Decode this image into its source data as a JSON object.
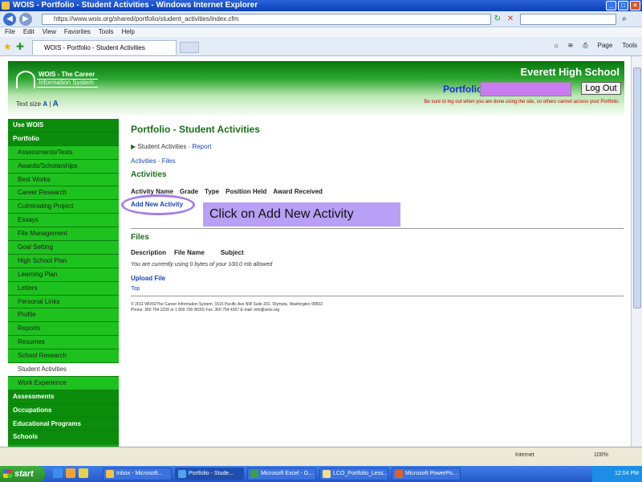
{
  "browser": {
    "title": "WOIS - Portfolio - Student Activities - Windows Internet Explorer",
    "url": "https://www.wois.org/shared/portfolio/student_activities/index.cfm",
    "search_placeholder": "",
    "menu": [
      "File",
      "Edit",
      "View",
      "Favorites",
      "Tools",
      "Help"
    ],
    "tab_label": "WOIS - Portfolio - Student Activities",
    "commands": [
      "Page",
      "Tools"
    ]
  },
  "header": {
    "logo_name": "WOIS - The Career",
    "logo_sub": "Information System",
    "text_size_label": "Text size",
    "text_size_small": "A",
    "text_size_large": "A",
    "school": "Everett High School",
    "portfolio_label": "Portfolio:",
    "logout": "Log Out",
    "warning": "Be sure to log out when you are done using the site, so others cannot access your Portfolio."
  },
  "sidebar": {
    "items": [
      {
        "label": "Use WOIS",
        "kind": "section"
      },
      {
        "label": "Portfolio",
        "kind": "section"
      },
      {
        "label": "Assessments/Tests",
        "kind": "sub"
      },
      {
        "label": "Awards/Scholarships",
        "kind": "sub"
      },
      {
        "label": "Best Works",
        "kind": "sub"
      },
      {
        "label": "Career Research",
        "kind": "sub"
      },
      {
        "label": "Culminating Project",
        "kind": "sub"
      },
      {
        "label": "Essays",
        "kind": "sub"
      },
      {
        "label": "File Management",
        "kind": "sub"
      },
      {
        "label": "Goal Setting",
        "kind": "sub"
      },
      {
        "label": "High School Plan",
        "kind": "sub"
      },
      {
        "label": "Learning Plan",
        "kind": "sub"
      },
      {
        "label": "Letters",
        "kind": "sub"
      },
      {
        "label": "Personal Links",
        "kind": "sub"
      },
      {
        "label": "Profile",
        "kind": "sub"
      },
      {
        "label": "Reports",
        "kind": "sub"
      },
      {
        "label": "Resumes",
        "kind": "sub"
      },
      {
        "label": "School Research",
        "kind": "sub"
      },
      {
        "label": "Student Activities",
        "kind": "sub"
      },
      {
        "label": "Work Experience",
        "kind": "sub"
      },
      {
        "label": "Assessments",
        "kind": "section"
      },
      {
        "label": "Occupations",
        "kind": "section"
      },
      {
        "label": "Educational Programs",
        "kind": "section"
      },
      {
        "label": "Schools",
        "kind": "section"
      }
    ]
  },
  "main": {
    "title": "Portfolio - Student Activities",
    "crumb_current": "Student Activities",
    "crumb_link": "Report",
    "sublink_1": "Activities",
    "sublink_sep": "·",
    "sublink_2": "Files",
    "activities_heading": "Activities",
    "activity_columns": [
      "Activity Name",
      "Grade",
      "Type",
      "Position Held",
      "Award Received"
    ],
    "add_activity": "Add New Activity",
    "callout": "Click on Add New Activity",
    "files_heading": "Files",
    "file_columns": [
      "Description",
      "File Name",
      "Subject"
    ],
    "usage": "You are currently using 0 bytes of your 100.0 mb allowed",
    "upload": "Upload File",
    "tiny_link": "Top",
    "footer_line1": "© 2011 WOIS/The Career Information System, 1515 Pacific Ave NW Suite 201, Olympia, Washington 98502",
    "footer_line2": "Phone: 360 754 2239 or 1 800 700 WOIS Fax: 360 754 4357 E-mail: info@wois.org"
  },
  "status": {
    "zone": "Internet",
    "zoom": "100%"
  },
  "taskbar": {
    "start": "start",
    "buttons": [
      "Inbox - Microsoft...",
      "Portfolio - Stude...",
      "Microsoft Excel - G...",
      "LCO_Portfolio_Less...",
      "Microsoft PowerPo..."
    ],
    "clock": "12:04 PM"
  }
}
